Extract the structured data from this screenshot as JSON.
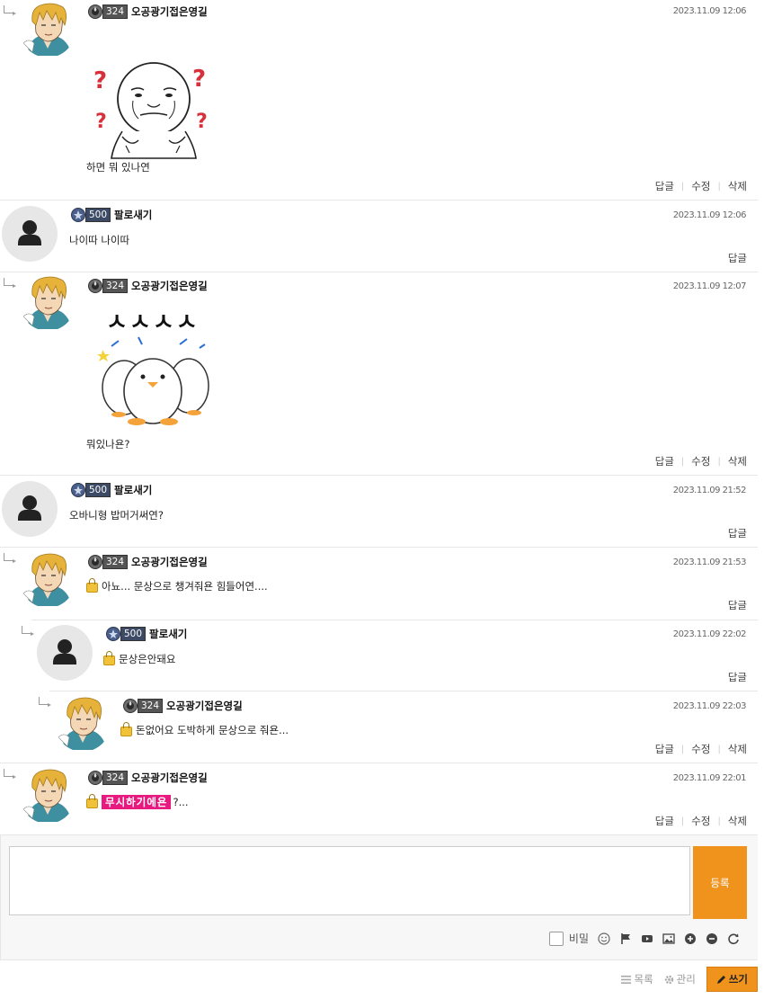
{
  "actions": {
    "reply": "답글",
    "edit": "수정",
    "delete": "삭제"
  },
  "comments": [
    {
      "level": "324",
      "nick": "오공광기접은영길",
      "date": "2023.11.09 12:06",
      "text": "하면 뭐 있나연"
    },
    {
      "level": "500",
      "nick": "팔로새기",
      "date": "2023.11.09 12:06",
      "text": "나이따 나이따"
    },
    {
      "level": "324",
      "nick": "오공광기접은영길",
      "date": "2023.11.09 12:07",
      "sticker_text": "ㅅㅅㅅㅅ",
      "text": "뭐있나욘?"
    },
    {
      "level": "500",
      "nick": "팔로새기",
      "date": "2023.11.09 21:52",
      "text": "오바니형 밥머거써연?"
    },
    {
      "level": "324",
      "nick": "오공광기접은영길",
      "date": "2023.11.09 21:53",
      "text": "아뇨... 문상으로 챙겨줘욘 힘들어연...."
    },
    {
      "level": "500",
      "nick": "팔로새기",
      "date": "2023.11.09 22:02",
      "text": "문상은안돼요"
    },
    {
      "level": "324",
      "nick": "오공광기접은영길",
      "date": "2023.11.09 22:03",
      "text": "돈없어요 도박하게 문상으로 줘욘..."
    },
    {
      "level": "324",
      "nick": "오공광기접은영길",
      "date": "2023.11.09 22:01",
      "highlight": "무시하기에욘",
      "text": "?..."
    }
  ],
  "editor": {
    "submit_label": "등록",
    "secret_label": "비밀"
  },
  "footer": {
    "list_label": "목록",
    "manage_label": "관리",
    "write_label": "쓰기"
  },
  "colors": {
    "accent": "#f0931d",
    "highlight": "#e8197f"
  },
  "icons": [
    "reply-arrow-icon",
    "level-badge-icon",
    "lock-icon",
    "emoji-icon",
    "flag-icon",
    "youtube-icon",
    "image-icon",
    "plus-icon",
    "minus-icon",
    "refresh-icon",
    "list-icon",
    "gear-icon",
    "pencil-icon"
  ]
}
